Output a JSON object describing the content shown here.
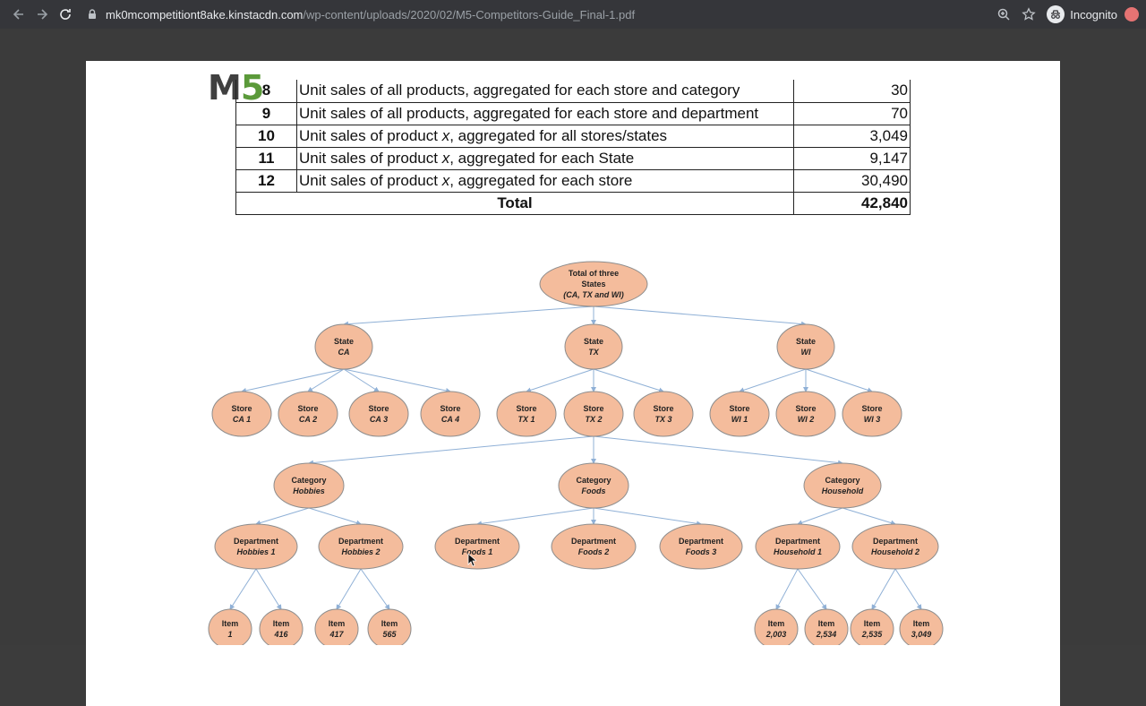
{
  "browser": {
    "url_host": "mk0mcompetitiont8ake.kinstacdn.com",
    "url_path": "/wp-content/uploads/2020/02/M5-Competitors-Guide_Final-1.pdf",
    "profile_label": "Incognito",
    "icons": [
      "back-icon",
      "forward-icon",
      "reload-icon",
      "lock-icon",
      "zoom-icon",
      "star-icon",
      "incognito-icon",
      "extension-icon"
    ]
  },
  "logo": {
    "m": "M",
    "five": "5"
  },
  "table": {
    "rows": [
      {
        "level": "8",
        "description": "Unit sales of all products, aggregated for each store and category",
        "count": "30"
      },
      {
        "level": "9",
        "description": "Unit sales of all products, aggregated for each store and department",
        "count": "70"
      },
      {
        "level": "10",
        "description": "Unit sales of product x, aggregated for all stores/states",
        "count": "3,049"
      },
      {
        "level": "11",
        "description": "Unit sales of product x, aggregated for each State",
        "count": "9,147"
      },
      {
        "level": "12",
        "description": "Unit sales of product x, aggregated for each store",
        "count": "30,490"
      }
    ],
    "total_label": "Total",
    "total_value": "42,840"
  },
  "tree": {
    "root": {
      "line1": "Total of three",
      "line2": "States",
      "line3": "(CA, TX and WI)"
    },
    "states": [
      {
        "line1": "State",
        "line2": "CA"
      },
      {
        "line1": "State",
        "line2": "TX"
      },
      {
        "line1": "State",
        "line2": "WI"
      }
    ],
    "stores": [
      {
        "line1": "Store",
        "line2": "CA 1"
      },
      {
        "line1": "Store",
        "line2": "CA 2"
      },
      {
        "line1": "Store",
        "line2": "CA 3"
      },
      {
        "line1": "Store",
        "line2": "CA 4"
      },
      {
        "line1": "Store",
        "line2": "TX 1"
      },
      {
        "line1": "Store",
        "line2": "TX 2"
      },
      {
        "line1": "Store",
        "line2": "TX 3"
      },
      {
        "line1": "Store",
        "line2": "WI 1"
      },
      {
        "line1": "Store",
        "line2": "WI 2"
      },
      {
        "line1": "Store",
        "line2": "WI 3"
      }
    ],
    "categories": [
      {
        "line1": "Category",
        "line2": "Hobbies"
      },
      {
        "line1": "Category",
        "line2": "Foods"
      },
      {
        "line1": "Category",
        "line2": "Household"
      }
    ],
    "departments": [
      {
        "line1": "Department",
        "line2": "Hobbies 1"
      },
      {
        "line1": "Department",
        "line2": "Hobbies 2"
      },
      {
        "line1": "Department",
        "line2": "Foods 1"
      },
      {
        "line1": "Department",
        "line2": "Foods 2"
      },
      {
        "line1": "Department",
        "line2": "Foods 3"
      },
      {
        "line1": "Department",
        "line2": "Household 1"
      },
      {
        "line1": "Department",
        "line2": "Household 2"
      }
    ],
    "items": [
      {
        "line1": "Item",
        "line2": "1"
      },
      {
        "line1": "Item",
        "line2": "416"
      },
      {
        "line1": "Item",
        "line2": "417"
      },
      {
        "line1": "Item",
        "line2": "565"
      },
      {
        "line1": "Item",
        "line2": "2,003"
      },
      {
        "line1": "Item",
        "line2": "2,534"
      },
      {
        "line1": "Item",
        "line2": "2,535"
      },
      {
        "line1": "Item",
        "line2": "3,049"
      }
    ]
  }
}
